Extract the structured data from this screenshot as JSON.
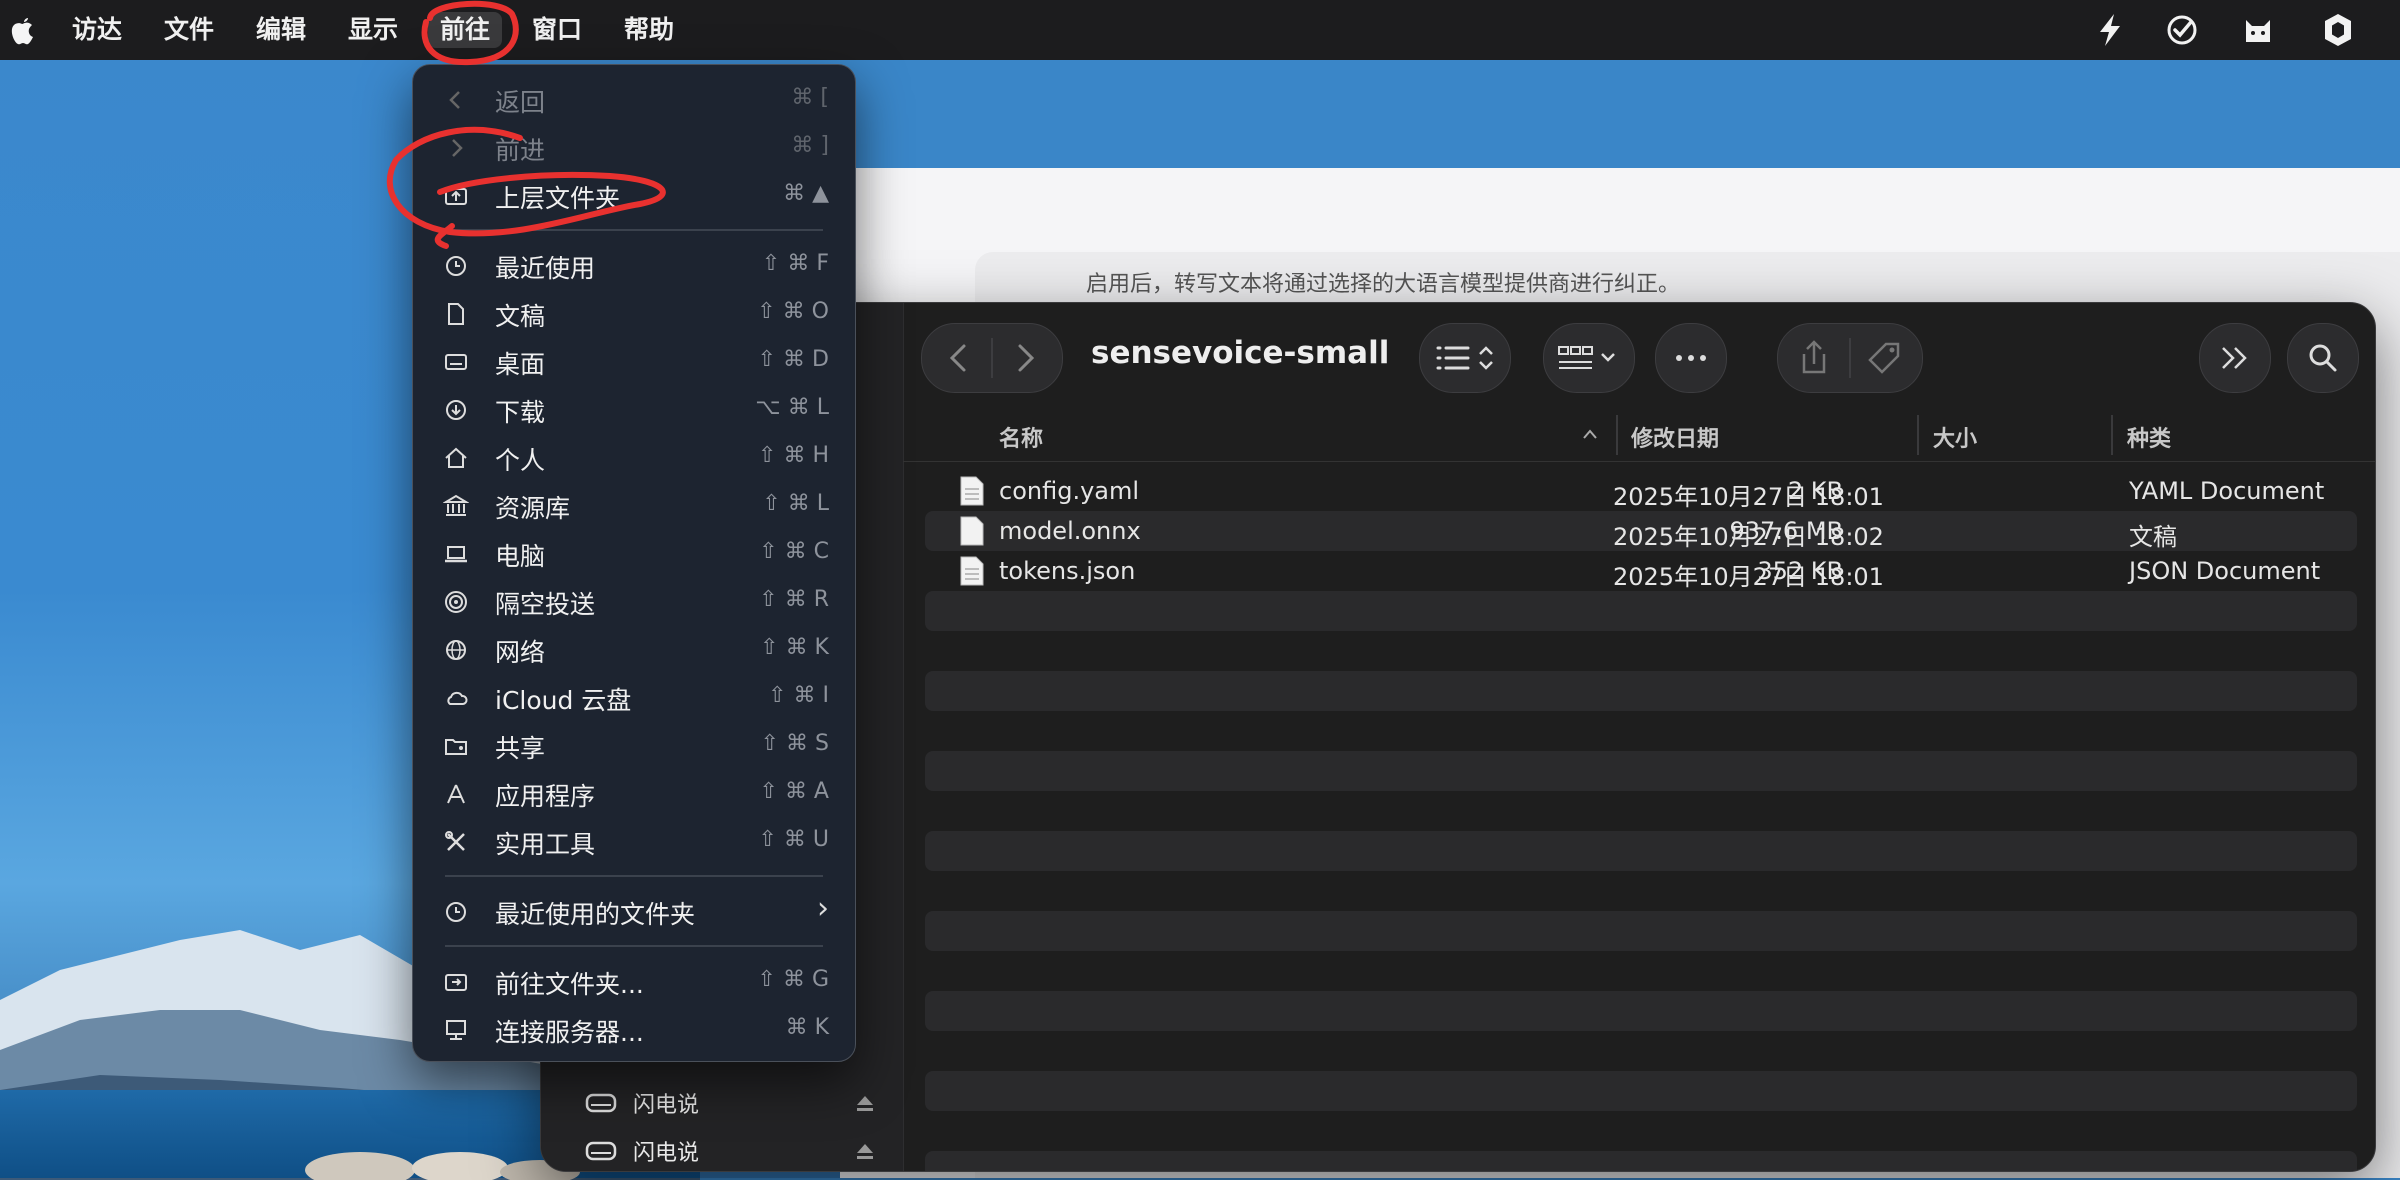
{
  "menubar": {
    "items": [
      "访达",
      "文件",
      "编辑",
      "显示",
      "前往",
      "窗口",
      "帮助"
    ],
    "active": "前往"
  },
  "background_window": {
    "description_text": "启用后，转写文本将通过选择的大语言模型提供商进行纠正。"
  },
  "finder": {
    "title": "sensevoice-small",
    "columns": {
      "name": "名称",
      "modified": "修改日期",
      "size": "大小",
      "kind": "种类"
    },
    "files": [
      {
        "name": "config.yaml",
        "modified": "2025年10月27日 18:01",
        "size": "2 KB",
        "kind": "YAML Document"
      },
      {
        "name": "model.onnx",
        "modified": "2025年10月27日 18:02",
        "size": "937.6 MB",
        "kind": "文稿"
      },
      {
        "name": "tokens.json",
        "modified": "2025年10月27日 18:01",
        "size": "352 KB",
        "kind": "JSON Document"
      }
    ],
    "sidebar_items": [
      {
        "label": "闪电说"
      },
      {
        "label": "闪电说"
      }
    ]
  },
  "go_menu": {
    "items": [
      {
        "label": "返回",
        "shortcut": "⌘ [",
        "icon": "chevron-left-icon",
        "disabled": true
      },
      {
        "label": "前进",
        "shortcut": "⌘ ]",
        "icon": "chevron-right-icon",
        "disabled": true
      },
      {
        "label": "上层文件夹",
        "shortcut": "⌘ ▲",
        "icon": "enclosing-folder-icon",
        "disabled": false
      },
      {
        "label": "最近使用",
        "shortcut": "⇧ ⌘ F",
        "icon": "clock-icon",
        "disabled": false
      },
      {
        "label": "文稿",
        "shortcut": "⇧ ⌘ O",
        "icon": "document-icon",
        "disabled": false
      },
      {
        "label": "桌面",
        "shortcut": "⇧ ⌘ D",
        "icon": "desktop-icon",
        "disabled": false
      },
      {
        "label": "下载",
        "shortcut": "⌥ ⌘ L",
        "icon": "download-icon",
        "disabled": false
      },
      {
        "label": "个人",
        "shortcut": "⇧ ⌘ H",
        "icon": "home-icon",
        "disabled": false
      },
      {
        "label": "资源库",
        "shortcut": "⇧ ⌘ L",
        "icon": "library-icon",
        "disabled": false
      },
      {
        "label": "电脑",
        "shortcut": "⇧ ⌘ C",
        "icon": "laptop-icon",
        "disabled": false
      },
      {
        "label": "隔空投送",
        "shortcut": "⇧ ⌘ R",
        "icon": "airdrop-icon",
        "disabled": false
      },
      {
        "label": "网络",
        "shortcut": "⇧ ⌘ K",
        "icon": "network-icon",
        "disabled": false
      },
      {
        "label": "iCloud 云盘",
        "shortcut": "⇧ ⌘ I",
        "icon": "cloud-icon",
        "disabled": false
      },
      {
        "label": "共享",
        "shortcut": "⇧ ⌘ S",
        "icon": "shared-folder-icon",
        "disabled": false
      },
      {
        "label": "应用程序",
        "shortcut": "⇧ ⌘ A",
        "icon": "applications-icon",
        "disabled": false
      },
      {
        "label": "实用工具",
        "shortcut": "⇧ ⌘ U",
        "icon": "utilities-icon",
        "disabled": false
      },
      {
        "label": "最近使用的文件夹",
        "shortcut": "›",
        "icon": "clock-icon",
        "disabled": false
      },
      {
        "label": "前往文件夹...",
        "shortcut": "⇧ ⌘ G",
        "icon": "go-folder-icon",
        "disabled": false
      },
      {
        "label": "连接服务器...",
        "shortcut": "⌘ K",
        "icon": "server-icon",
        "disabled": false
      }
    ]
  },
  "colors": {
    "menu_bg": "#1d2430",
    "annotation": "#e8312f",
    "finder_bg": "#1e1e1e"
  }
}
